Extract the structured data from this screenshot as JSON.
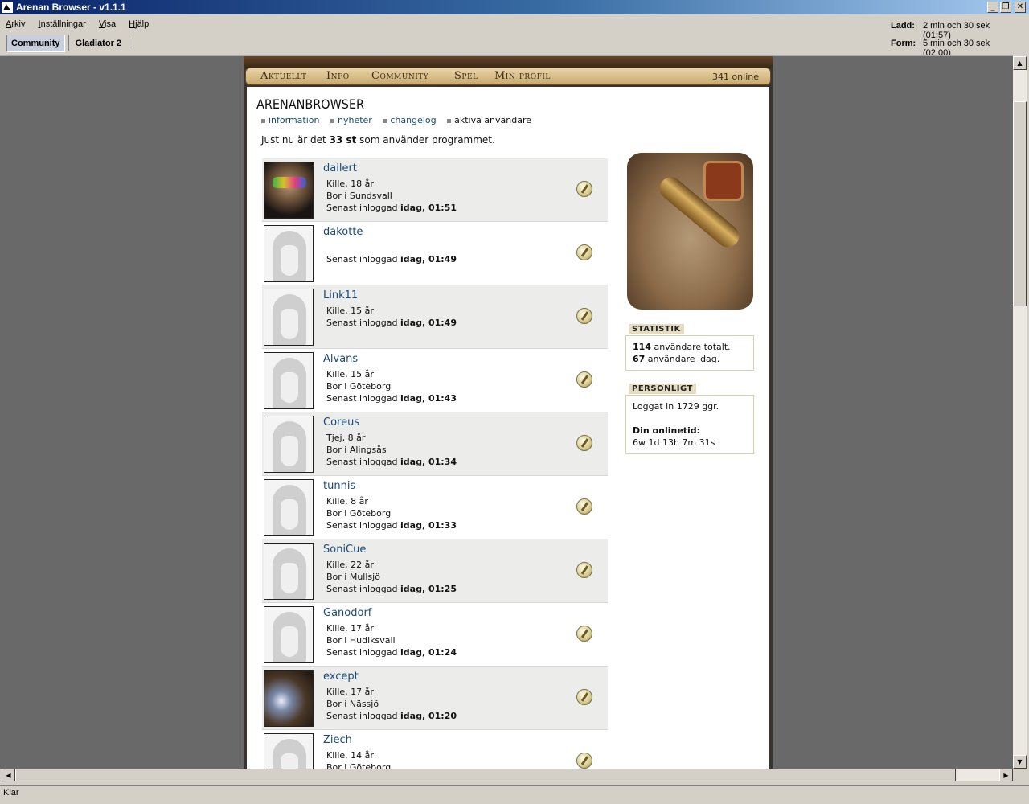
{
  "window": {
    "title": "Arenan Browser - v1.1.1"
  },
  "menu": [
    "Arkiv",
    "Inställningar",
    "Visa",
    "Hjälp"
  ],
  "timers": [
    {
      "label": "Ladd:",
      "value": "2 min och 30 sek (01:57)"
    },
    {
      "label": "Form:",
      "value": "5 min och 30 sek (02:00)"
    }
  ],
  "tabs": [
    "Community",
    "Gladiator 2"
  ],
  "site": {
    "nav": [
      "Aktuellt",
      "Info",
      "Community",
      "Spel",
      "Min profil"
    ],
    "online": "341 online",
    "title": "ARENANBROWSER",
    "sublinks": [
      "information",
      "nyheter",
      "changelog",
      "aktiva användare"
    ],
    "intro_prefix": "Just nu är det ",
    "intro_count": "33 st",
    "intro_suffix": " som använder programmet."
  },
  "users": [
    {
      "name": "dailert",
      "lines": [
        "Kille, 18 år",
        "Bor i Sundsvall"
      ],
      "last_prefix": "Senast inloggad ",
      "last": "idag, 01:51",
      "avatar": "photo"
    },
    {
      "name": "dakotte",
      "lines": [],
      "last_prefix": "Senast inloggad ",
      "last": "idag, 01:49",
      "avatar": "placeholder"
    },
    {
      "name": "Link11",
      "lines": [
        "Kille, 15 år"
      ],
      "last_prefix": "Senast inloggad ",
      "last": "idag, 01:49",
      "avatar": "placeholder"
    },
    {
      "name": "Alvans",
      "lines": [
        "Kille, 15 år",
        "Bor i Göteborg"
      ],
      "last_prefix": "Senast inloggad ",
      "last": "idag, 01:43",
      "avatar": "placeholder"
    },
    {
      "name": "Coreus",
      "lines": [
        "Tjej, 8 år",
        "Bor i Alingsås"
      ],
      "last_prefix": "Senast inloggad ",
      "last": "idag, 01:34",
      "avatar": "placeholder"
    },
    {
      "name": "tunnis",
      "lines": [
        "Kille, 8 år",
        "Bor i Göteborg"
      ],
      "last_prefix": "Senast inloggad ",
      "last": "idag, 01:33",
      "avatar": "placeholder"
    },
    {
      "name": "SoniCue",
      "lines": [
        "Kille, 22 år",
        "Bor i Mullsjö"
      ],
      "last_prefix": "Senast inloggad ",
      "last": "idag, 01:25",
      "avatar": "placeholder"
    },
    {
      "name": "Ganodorf",
      "lines": [
        "Kille, 17 år",
        "Bor i Hudiksvall"
      ],
      "last_prefix": "Senast inloggad ",
      "last": "idag, 01:24",
      "avatar": "placeholder"
    },
    {
      "name": "except",
      "lines": [
        "Kille, 17 år",
        "Bor i Nässjö"
      ],
      "last_prefix": "Senast inloggad ",
      "last": "idag, 01:20",
      "avatar": "photo"
    },
    {
      "name": "Ziech",
      "lines": [
        "Kille, 14 år",
        "Bor i Göteborg"
      ],
      "last_prefix": "",
      "last": "",
      "avatar": "placeholder"
    }
  ],
  "stats": {
    "label": "STATISTIK",
    "total_num": "114",
    "total_text": " användare totalt.",
    "today_num": "67",
    "today_text": " användare idag."
  },
  "personal": {
    "label": "PERSONLIGT",
    "logins": "Loggat in 1729 ggr.",
    "online_label": "Din onlinetid:",
    "online_time": "6w 1d 13h 7m 31s"
  },
  "status": "Klar"
}
